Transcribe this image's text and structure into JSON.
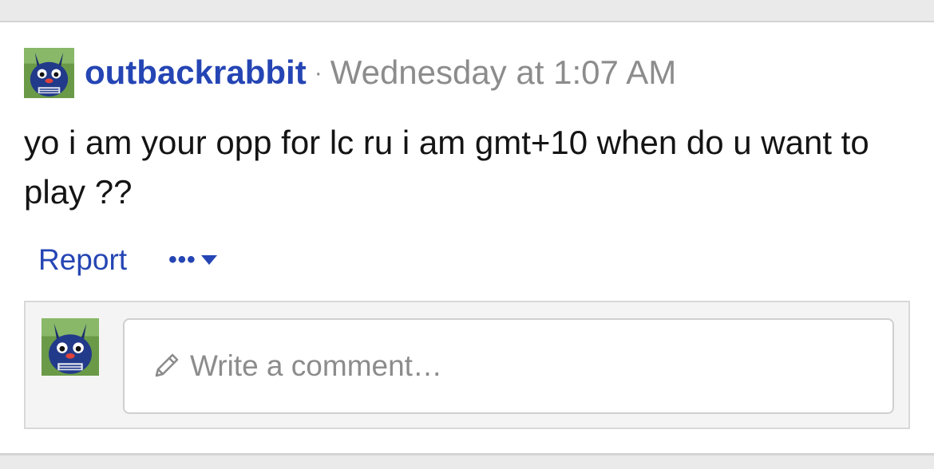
{
  "post": {
    "username": "outbackrabbit",
    "separator": "·",
    "timestamp": "Wednesday at 1:07 AM",
    "message": "yo i am your opp for lc ru i am gmt+10 when do u want to play ??"
  },
  "actions": {
    "report_label": "Report",
    "more_label": "•••"
  },
  "comment": {
    "placeholder": "Write a comment…"
  },
  "icons": {
    "avatar": "pokemon-avatar-icon",
    "pencil": "pencil-icon",
    "caret": "caret-down-icon"
  },
  "colors": {
    "link": "#2545b4",
    "muted": "#8c8c8c",
    "text": "#141414"
  }
}
